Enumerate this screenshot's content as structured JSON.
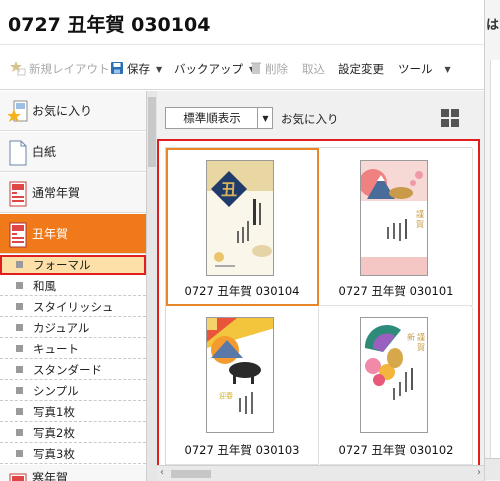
{
  "window": {
    "title": "0727 丑年賀 030104",
    "side_title": "は"
  },
  "toolbar": {
    "new_layout": "新規レイアウト",
    "save": "保存",
    "backup": "バックアップ",
    "delete": "削除",
    "import": "取込",
    "settings": "設定変更",
    "tools": "ツール"
  },
  "sidebar": {
    "favorites": "お気に入り",
    "blank": "白紙",
    "regular_new_year": "通常年賀",
    "ox_new_year": "丑年賀",
    "categories": [
      "フォーマル",
      "和風",
      "スタイリッシュ",
      "カジュアル",
      "キュート",
      "スタンダード",
      "シンプル",
      "写真1枚",
      "写真2枚",
      "写真3枚"
    ],
    "next_category": "寒年賀",
    "selected_category": "フォーマル",
    "active_section": "丑年賀"
  },
  "main": {
    "sort_label": "標準順表示",
    "breadcrumb": "お気に入り",
    "cards": [
      {
        "name": "0727 丑年賀 030104",
        "selected": true,
        "icon": "ox-kanji-card"
      },
      {
        "name": "0727 丑年賀 030101",
        "selected": false,
        "icon": "mt-fuji-ox-card"
      },
      {
        "name": "0727 丑年賀 030103",
        "selected": false,
        "icon": "sunrise-ox-card"
      },
      {
        "name": "0727 丑年賀 030102",
        "selected": false,
        "icon": "fan-ox-card"
      }
    ]
  },
  "colors": {
    "accent": "#f07a1a",
    "highlight_border": "#e11d1d",
    "selected_card_border": "#e8862a",
    "selected_sub_bg": "#fde0a8"
  }
}
